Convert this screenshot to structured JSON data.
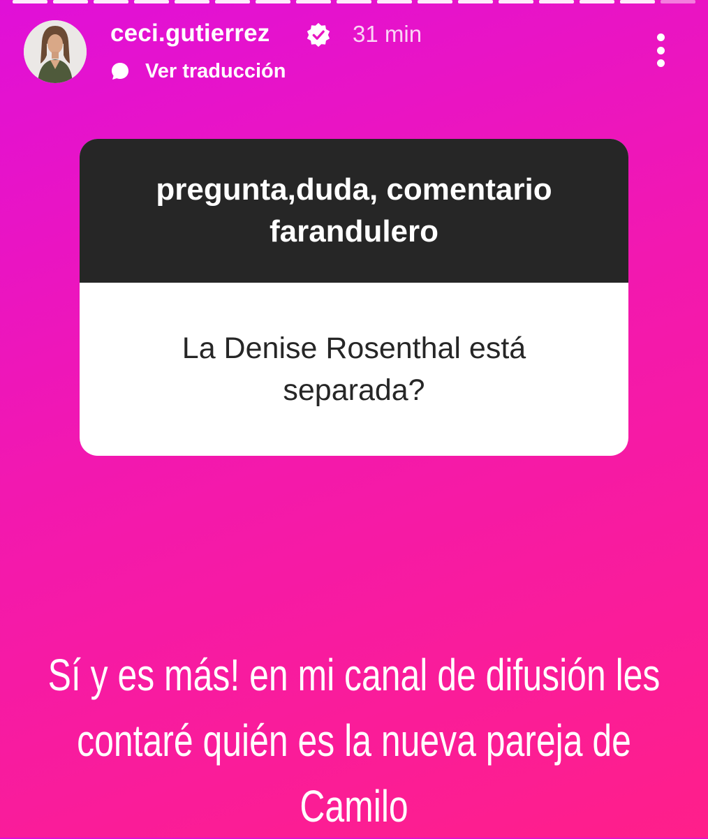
{
  "story": {
    "progress": {
      "total_segments": 17,
      "completed_segments": 16
    },
    "header": {
      "username": "ceci.gutierrez",
      "time_ago": "31 min",
      "translate_label": "Ver traducción",
      "icons": {
        "verified": "verified-badge-icon",
        "translate": "speech-bubble-icon",
        "more": "more-vertical-icon"
      }
    },
    "question_sticker": {
      "prompt": "pregunta,duda, comentario farandulero",
      "question": "La Denise Rosenthal está separada?"
    },
    "response_text": "Sí y es más! en mi canal de difusión les contaré quién es la nueva pareja de Camilo"
  },
  "colors": {
    "gradient_start": "#e010d8",
    "gradient_end": "#ff1f8a",
    "sticker_header": "#262626",
    "sticker_body": "#ffffff"
  }
}
